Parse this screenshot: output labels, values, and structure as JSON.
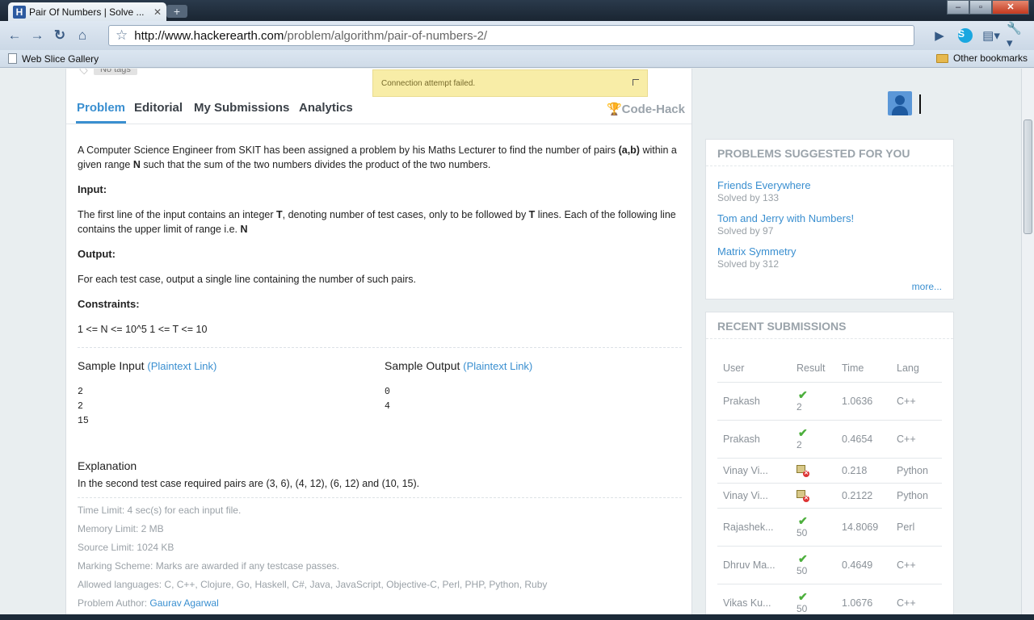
{
  "browser": {
    "tab_title": "Pair Of Numbers | Solve ...",
    "tab_favicon": "H",
    "tab_close": "✕",
    "new_tab": "+",
    "url_domain": "http://www.hackerearth.com",
    "url_path": "/problem/algorithm/pair-of-numbers-2/",
    "bookmark_web_slice": "Web Slice Gallery",
    "bookmark_other": "Other bookmarks"
  },
  "page": {
    "no_tags": "No tags",
    "notice": "Connection attempt failed.",
    "tabs": {
      "problem": "Problem",
      "editorial": "Editorial",
      "my_submissions": "My Submissions",
      "analytics": "Analytics",
      "code_hack": "Code-Hack"
    },
    "problem": {
      "intro_a": "A Computer Science Engineer from SKIT has been assigned a problem by his Maths Lecturer to find the number of pairs ",
      "intro_ab": "(a,b)",
      "intro_b": " within a given range ",
      "intro_n": "N",
      "intro_c": " such that the sum of the two numbers divides the product of the two numbers.",
      "input_h": "Input",
      "input_a": "The first line of the input contains an integer ",
      "input_t": "T",
      "input_b": ", denoting number of test cases, only to be followed by ",
      "input_t2": "T",
      "input_c": " lines. Each of the following line contains the upper limit of range i.e. ",
      "input_n": "N",
      "output_h": "Output",
      "output_t": "For each test case, output a single line containing the number of such pairs.",
      "constraints_h": "Constraints",
      "constraints_t": "1 <= N <= 10^5 1 <= T <= 10",
      "sample_input_h": "Sample Input",
      "sample_output_h": "Sample Output",
      "plaintext_link": "(Plaintext Link)",
      "sample_input": "2\n2\n15",
      "sample_output": "0\n4",
      "explanation_h": "Explanation",
      "explanation_t": "In the second test case required pairs are (3, 6), (4, 12), (6, 12) and (10, 15).",
      "time_limit": "Time Limit: 4 sec(s) for each input file.",
      "memory_limit": "Memory Limit: 2 MB",
      "source_limit": "Source Limit: 1024 KB",
      "marking_scheme": "Marking Scheme: Marks are awarded if any testcase passes.",
      "allowed_languages": "Allowed languages: C, C++, Clojure, Go, Haskell, C#, Java, JavaScript, Objective-C, Perl, PHP, Python, Ruby",
      "author_label": "Problem Author: ",
      "author_name": "Gaurav Agarwal"
    }
  },
  "sidebar": {
    "suggested_h": "PROBLEMS SUGGESTED FOR YOU",
    "suggested": [
      {
        "name": "Friends Everywhere",
        "solved": "Solved by 133"
      },
      {
        "name": "Tom and Jerry with Numbers!",
        "solved": "Solved by 97"
      },
      {
        "name": "Matrix Symmetry",
        "solved": "Solved by 312"
      }
    ],
    "more": "more...",
    "recent_h": "RECENT SUBMISSIONS",
    "columns": [
      "User",
      "Result",
      "Time",
      "Lang"
    ],
    "submissions": [
      {
        "user": "Prakash",
        "status": "accepted",
        "score": "2",
        "time": "1.0636",
        "lang": "C++"
      },
      {
        "user": "Prakash",
        "status": "accepted",
        "score": "2",
        "time": "0.4654",
        "lang": "C++"
      },
      {
        "user": "Vinay Vi...",
        "status": "error",
        "score": "",
        "time": "0.218",
        "lang": "Python"
      },
      {
        "user": "Vinay Vi...",
        "status": "error",
        "score": "",
        "time": "0.2122",
        "lang": "Python"
      },
      {
        "user": "Rajashek...",
        "status": "accepted",
        "score": "50",
        "time": "14.8069",
        "lang": "Perl"
      },
      {
        "user": "Dhruv Ma...",
        "status": "accepted",
        "score": "50",
        "time": "0.4649",
        "lang": "C++"
      },
      {
        "user": "Vikas Ku...",
        "status": "accepted",
        "score": "50",
        "time": "1.0676",
        "lang": "C++"
      }
    ]
  },
  "colors": {
    "accent": "#3a8fd0",
    "success": "#4caf3c",
    "notice_bg": "#f8eda7"
  }
}
